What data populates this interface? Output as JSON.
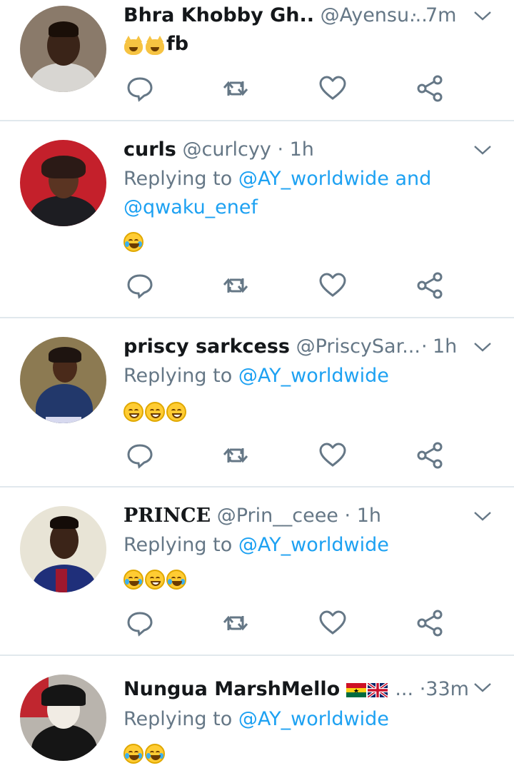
{
  "colors": {
    "link": "#1da1f2",
    "secondary": "#657786",
    "divider": "#e1e8ed",
    "icon": "#657786"
  },
  "icons": {
    "reply": "reply-icon",
    "retweet": "retweet-icon",
    "like": "like-icon",
    "share": "share-icon",
    "menu": "chevron-down-icon"
  },
  "tweets": [
    {
      "name": "Bhra Khobby Gh..",
      "handle": "@Ayensu...",
      "sep": "·",
      "time": "7m",
      "reply_prefix": "",
      "mentions": "",
      "text": "fb",
      "emoji": [
        "cat-joy",
        "cat-joy"
      ]
    },
    {
      "name": "curls",
      "handle": "@curlcyy",
      "sep": "·",
      "time": "1h",
      "reply_prefix": "Replying to",
      "mentions": "@AY_worldwide and",
      "mentions2": "@qwaku_enef",
      "text": "",
      "emoji": [
        "joy"
      ]
    },
    {
      "name": "priscy sarkcess",
      "handle": "@PriscySar...",
      "sep": "·",
      "time": "1h",
      "reply_prefix": "Replying to",
      "mentions": "@AY_worldwide",
      "text": "",
      "emoji": [
        "grin",
        "grin",
        "grin"
      ]
    },
    {
      "name": "PRINCE",
      "handle": "@Prin__ceee",
      "sep": "·",
      "time": "1h",
      "reply_prefix": "Replying to",
      "mentions": "@AY_worldwide",
      "text": "",
      "emoji": [
        "joy",
        "grin",
        "joy"
      ]
    },
    {
      "name": "Nungua MarshMello",
      "name_suffix": "...",
      "handle": "",
      "sep": "·",
      "time": "33m",
      "reply_prefix": "Replying to",
      "mentions": "@AY_worldwide",
      "text": "",
      "emoji": [
        "joy",
        "joy"
      ],
      "flags": [
        "ghana-flag",
        "uk-flag"
      ]
    }
  ]
}
